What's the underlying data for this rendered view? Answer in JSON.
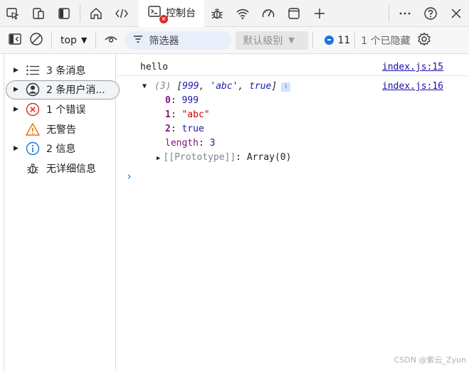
{
  "tabbar": {
    "active_tab_label": "控制台",
    "active_tab_error_badge": "×",
    "icons": [
      "inspect-icon",
      "device-emulation-icon",
      "sidebar-toggle-icon",
      "home-icon",
      "elements-code-icon",
      "console-icon",
      "bug-icon",
      "wifi-icon",
      "performance-gauge-icon",
      "application-square-icon",
      "add-tab-icon",
      "more-icon",
      "help-icon",
      "close-icon"
    ]
  },
  "console_toolbar": {
    "context": "top",
    "filter_placeholder": "筛选器",
    "levels_label": "默认级别",
    "issues_count": "11",
    "hidden_count": "1 个已隐藏"
  },
  "sidebar": {
    "items": [
      {
        "label": "3 条消息",
        "icon": "list-icon",
        "has_arrow": true
      },
      {
        "label": "2 条用户消...",
        "icon": "user-icon",
        "has_arrow": true,
        "selected": true
      },
      {
        "label": "1 个错误",
        "icon": "error-icon",
        "has_arrow": true
      },
      {
        "label": "无警告",
        "icon": "warning-icon",
        "has_arrow": false
      },
      {
        "label": "2 信息",
        "icon": "info-icon",
        "has_arrow": true
      },
      {
        "label": "无详细信息",
        "icon": "bug-icon",
        "has_arrow": false
      }
    ]
  },
  "console": {
    "messages": [
      {
        "text": "hello",
        "source": "index.js:15"
      },
      {
        "summary_count": "(3)",
        "summary_open": "[",
        "summary_v1": "999",
        "summary_v2": "'abc'",
        "summary_v3": "true",
        "summary_close": "]",
        "info_badge": "i",
        "source": "index.js:16",
        "props": [
          {
            "key": "0",
            "value": "999",
            "kind": "num"
          },
          {
            "key": "1",
            "value": "\"abc\"",
            "kind": "str"
          },
          {
            "key": "2",
            "value": "true",
            "kind": "bool"
          },
          {
            "key": "length",
            "value": "3",
            "kind": "num"
          }
        ],
        "proto_key": "[[Prototype]]",
        "proto_value": "Array(0)"
      }
    ],
    "prompt": "›"
  },
  "watermark": "CSDN @紫云_Zyun",
  "colors": {
    "accent": "#1a73e8",
    "error": "#d93025",
    "warning": "#e8710a",
    "prop_key": "#881280",
    "string": "#c80000",
    "number": "#1a1aa6",
    "link": "#1a0dab"
  }
}
